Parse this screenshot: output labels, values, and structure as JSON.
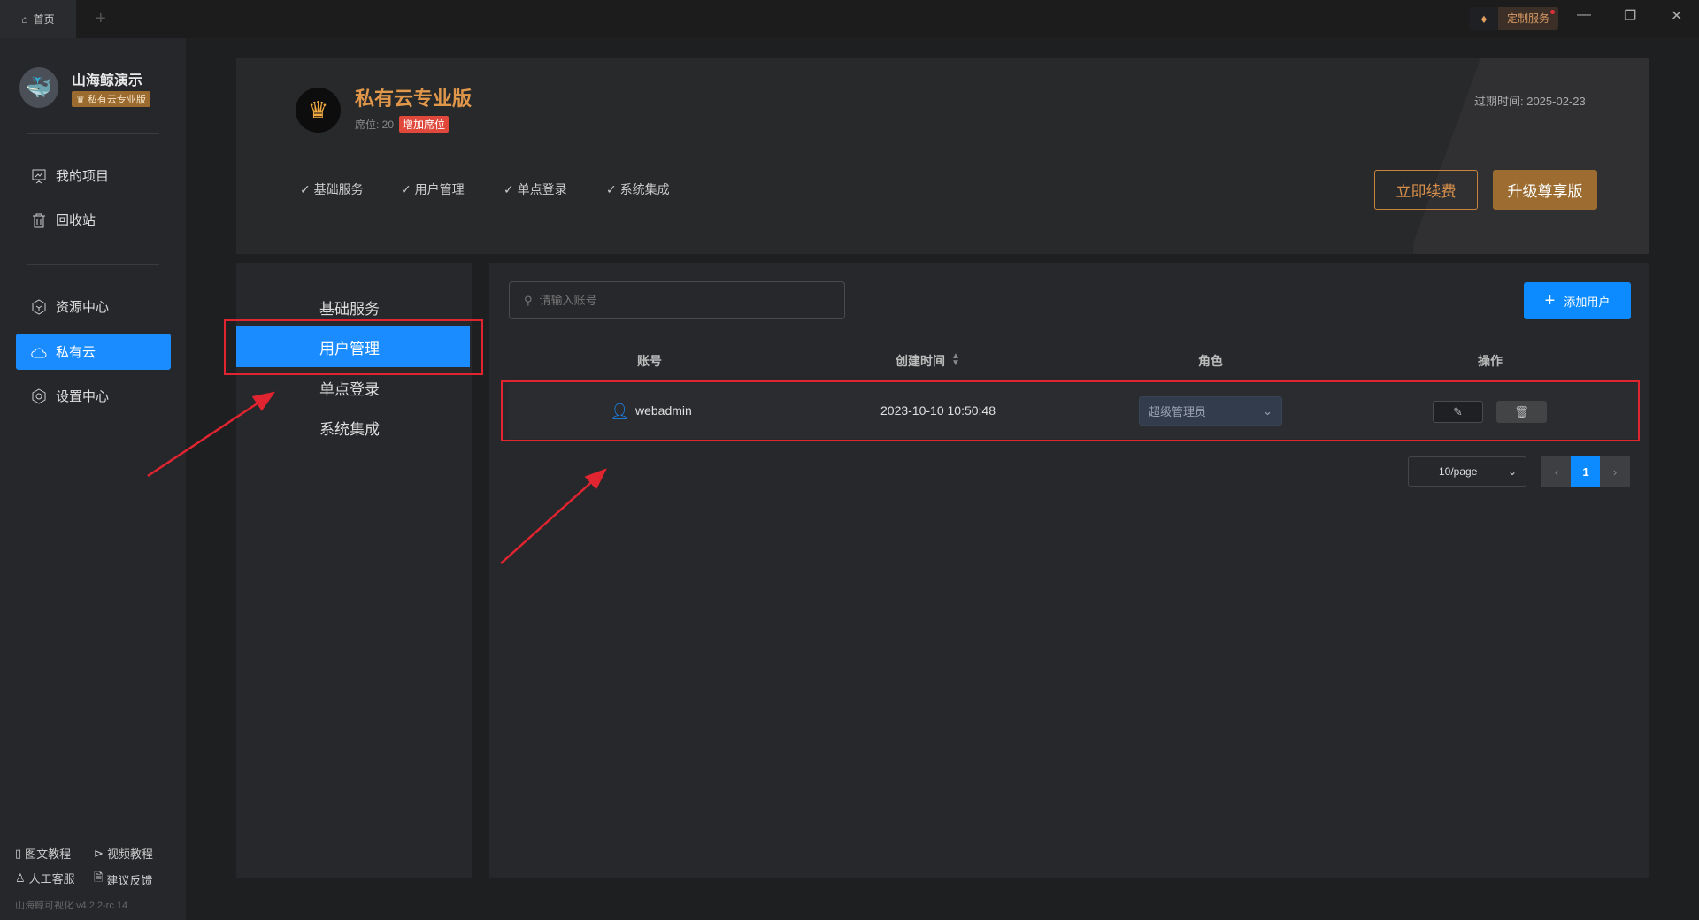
{
  "titlebar": {
    "home_tab": "首页",
    "custom_service": "定制服务"
  },
  "sidebar": {
    "brand": "山海鲸演示",
    "badge": "私有云专业版",
    "items": [
      {
        "label": "我的项目"
      },
      {
        "label": "回收站"
      },
      {
        "label": "资源中心"
      },
      {
        "label": "私有云"
      },
      {
        "label": "设置中心"
      }
    ],
    "footer": {
      "tutorial_text": "图文教程",
      "tutorial_video": "视频教程",
      "support": "人工客服",
      "feedback": "建议反馈",
      "version": "山海鲸可视化 v4.2.2-rc.14"
    }
  },
  "plan": {
    "title": "私有云专业版",
    "seats": "席位: 20",
    "add_seats": "增加席位",
    "expire": "过期时间:  2025-02-23",
    "features": [
      "基础服务",
      "用户管理",
      "单点登录",
      "系统集成"
    ],
    "renew": "立即续费",
    "upgrade": "升级尊享版"
  },
  "submenu": [
    "基础服务",
    "用户管理",
    "单点登录",
    "系统集成"
  ],
  "users": {
    "search_placeholder": "请输入账号",
    "add_user": "添加用户",
    "columns": [
      "账号",
      "创建时间",
      "角色",
      "操作"
    ],
    "rows": [
      {
        "account": "webadmin",
        "created": "2023-10-10 10:50:48",
        "role": "超级管理员"
      }
    ],
    "page_size": "10/page",
    "current_page": "1"
  },
  "colors": {
    "accent": "#1a8cff",
    "gold": "#e0974a",
    "highlight": "#e02430"
  }
}
